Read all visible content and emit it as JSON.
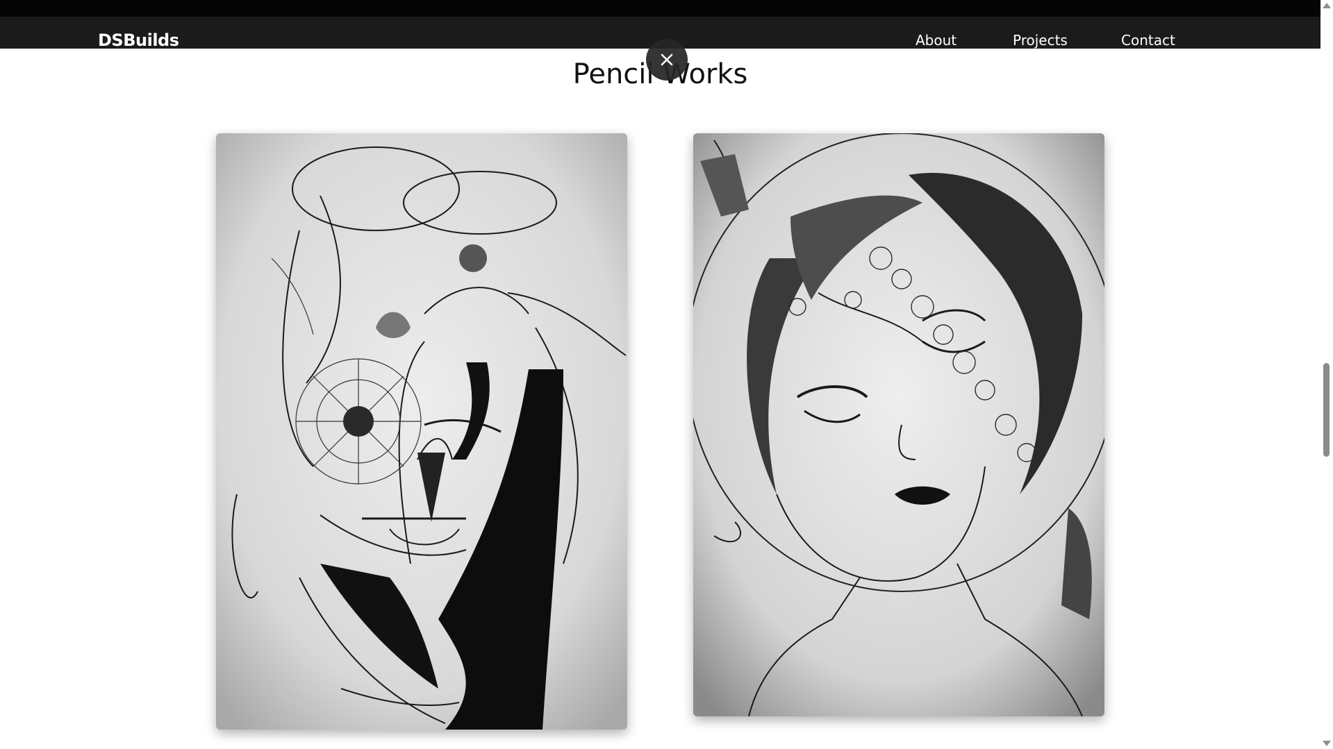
{
  "header": {
    "brand": "DSBuilds",
    "nav": [
      {
        "label": "About"
      },
      {
        "label": "Projects"
      },
      {
        "label": "Contact"
      }
    ]
  },
  "section": {
    "title": "Pencil Works"
  },
  "gallery": {
    "close_icon": "close-icon",
    "items": [
      {
        "description_icon": "pencil-drawing-woman-flower-face"
      },
      {
        "description_icon": "pencil-drawing-woman-floral-crack"
      }
    ]
  },
  "colors": {
    "navbar": "#1b1b1b",
    "topstrip": "#040404",
    "close_button": "#262626",
    "page_background": "#ffffff"
  }
}
